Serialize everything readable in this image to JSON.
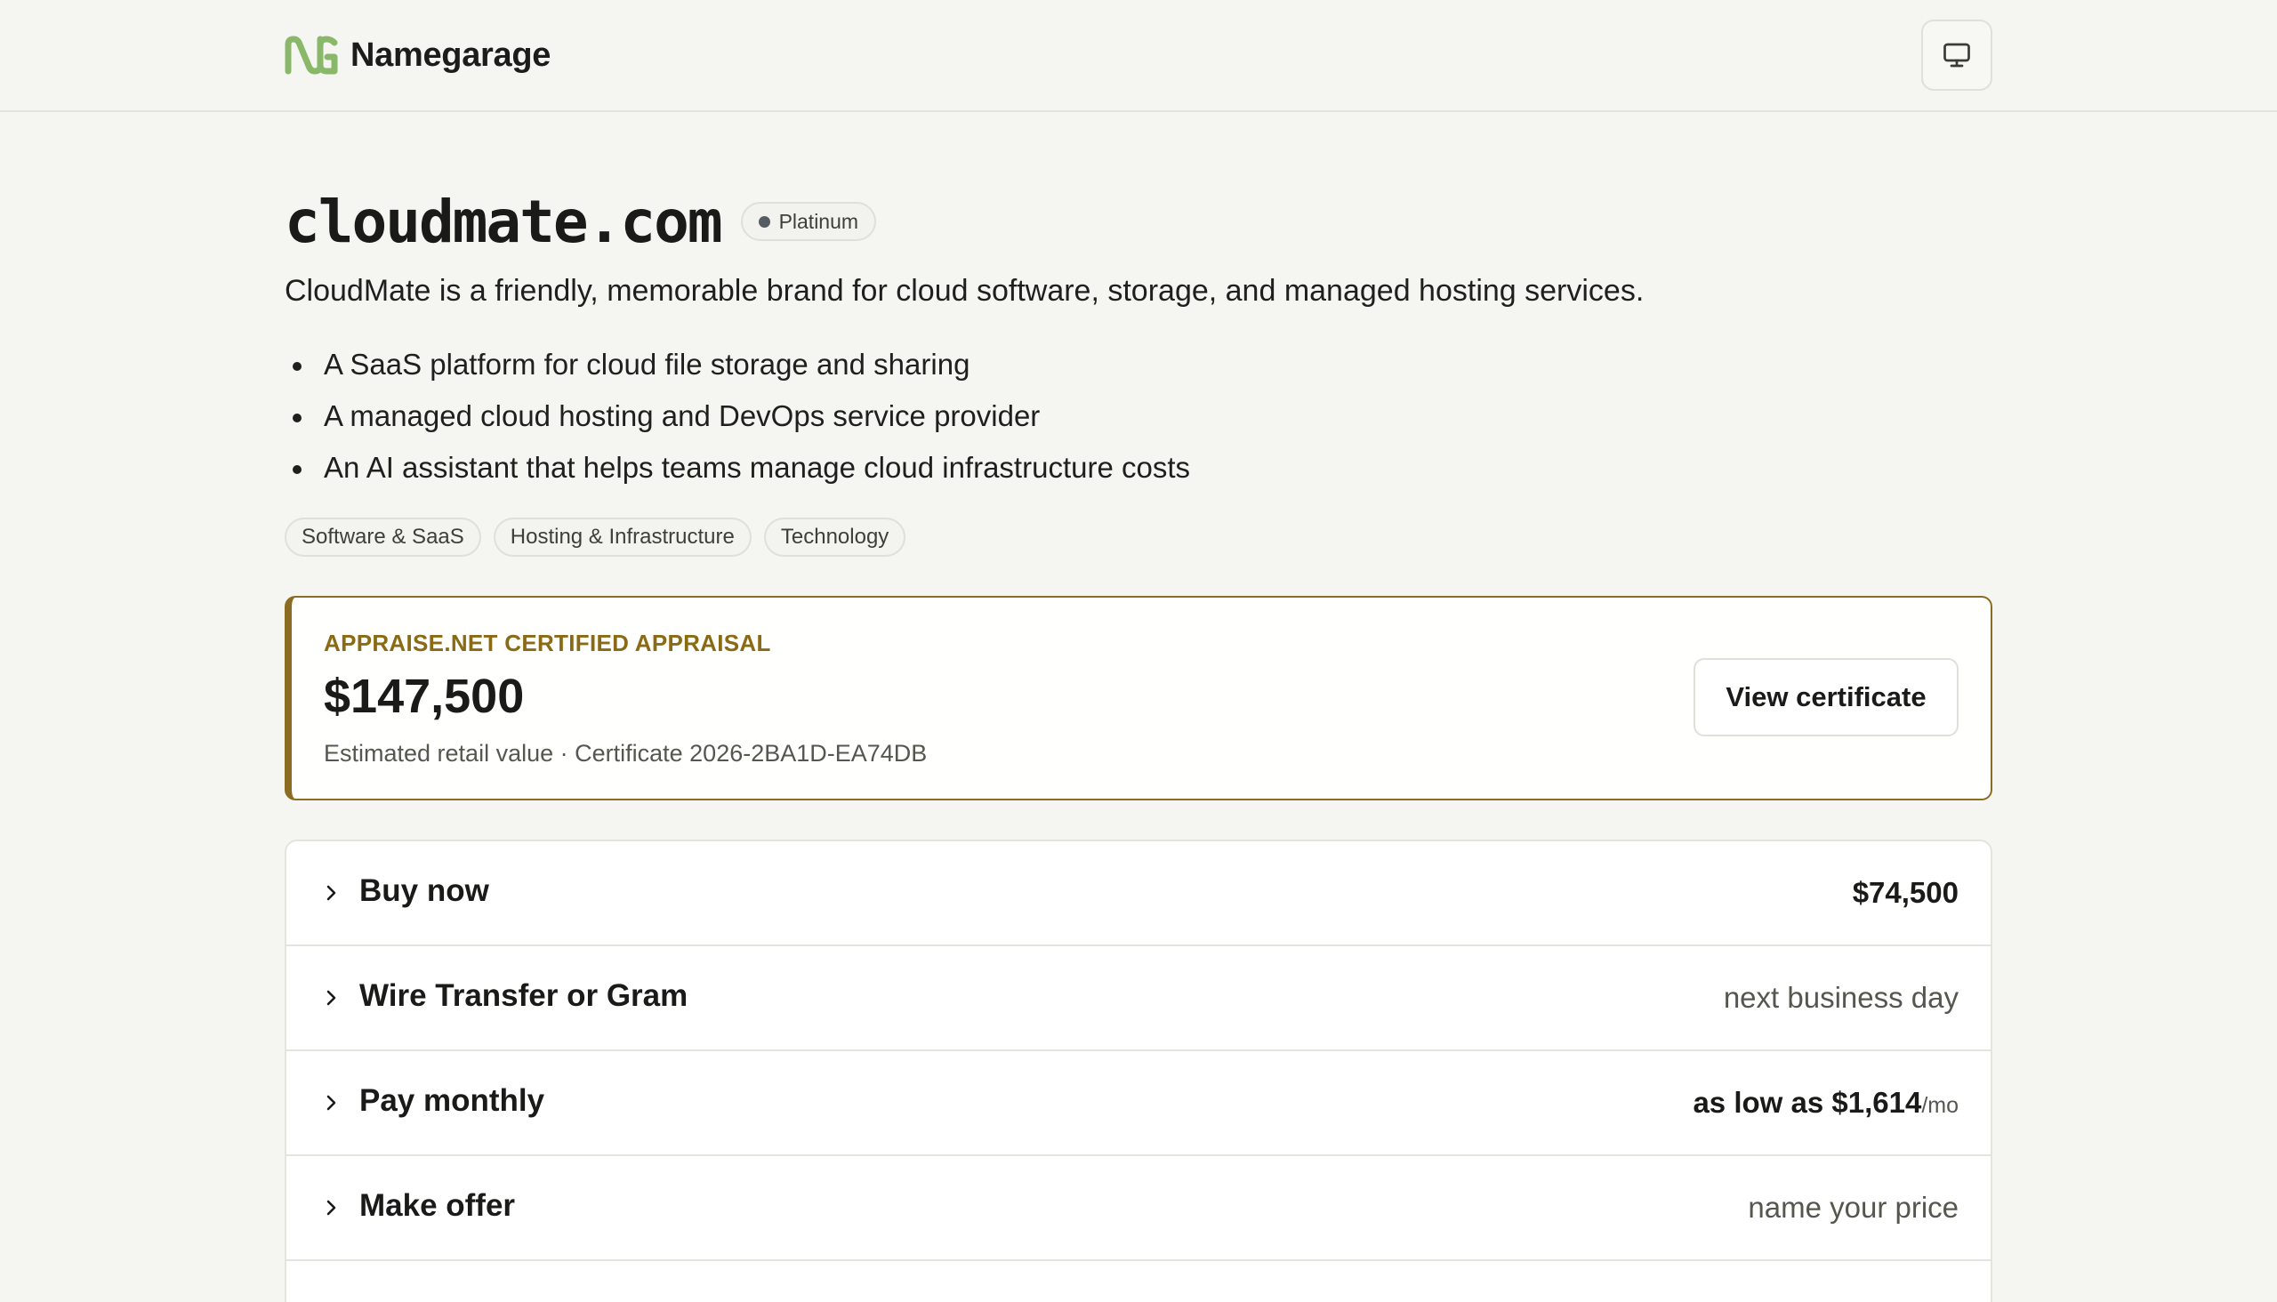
{
  "brand": {
    "name": "Namegarage",
    "logo_icon": "ng-logo-icon",
    "accent": "#8ab86a"
  },
  "header": {
    "display_button_icon": "monitor-icon"
  },
  "domain": {
    "name": "cloudmate.com",
    "tier": "Platinum",
    "description": "CloudMate is a friendly, memorable brand for cloud software, storage, and managed hosting services.",
    "use_cases": [
      "A SaaS platform for cloud file storage and sharing",
      "A managed cloud hosting and DevOps service provider",
      "An AI assistant that helps teams manage cloud infrastructure costs"
    ],
    "tags": [
      "Software & SaaS",
      "Hosting & Infrastructure",
      "Technology"
    ]
  },
  "appraisal": {
    "label": "APPRAISE.NET CERTIFIED APPRAISAL",
    "value": "$147,500",
    "subtext": "Estimated retail value · Certificate 2026-2BA1D-EA74DB",
    "button_label": "View certificate",
    "accent": "#8a6d22"
  },
  "purchase_options": [
    {
      "label": "Buy now",
      "value": "$74,500",
      "unit": ""
    },
    {
      "label": "Wire Transfer or Gram",
      "value": "next business day",
      "unit": ""
    },
    {
      "label": "Pay monthly",
      "value": "as low as $1,614",
      "unit": "/mo"
    },
    {
      "label": "Make offer",
      "value": "name your price",
      "unit": ""
    }
  ]
}
